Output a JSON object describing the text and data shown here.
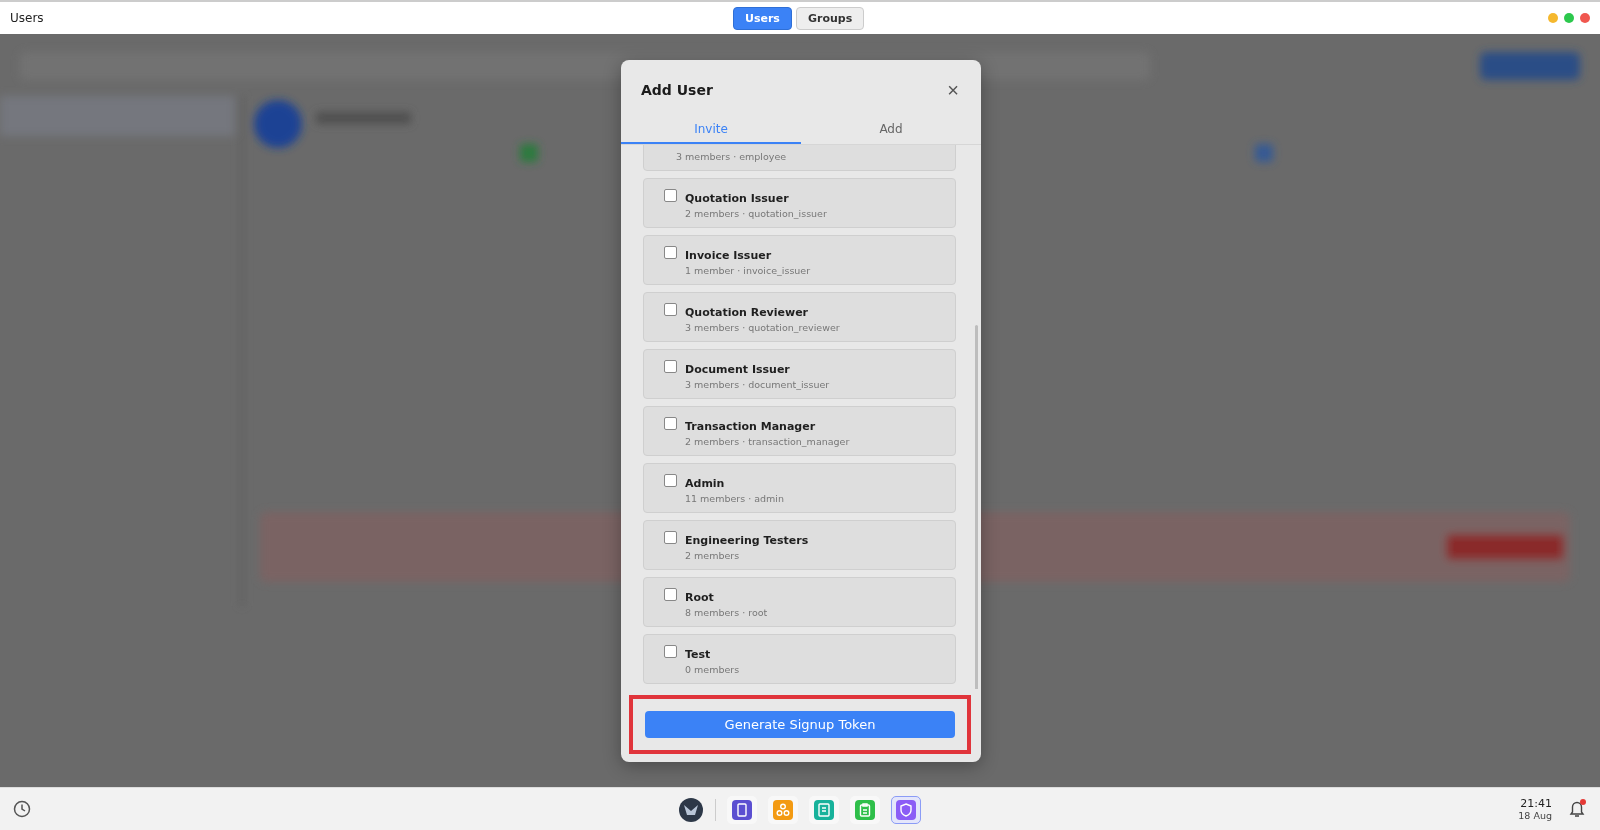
{
  "window": {
    "title": "Users"
  },
  "view_switch": [
    {
      "label": "Users",
      "selected": true
    },
    {
      "label": "Groups",
      "selected": false
    }
  ],
  "dialog": {
    "title": "Add User",
    "close": "×",
    "tabs": [
      {
        "label": "Invite",
        "selected": true
      },
      {
        "label": "Add",
        "selected": false
      }
    ],
    "groups": [
      {
        "meta": "3 members · employee"
      },
      {
        "name": "Quotation Issuer",
        "meta": "2 members · quotation_issuer",
        "checked": false
      },
      {
        "name": "Invoice Issuer",
        "meta": "1 member · invoice_issuer",
        "checked": false
      },
      {
        "name": "Quotation Reviewer",
        "meta": "3 members · quotation_reviewer",
        "checked": false
      },
      {
        "name": "Document Issuer",
        "meta": "3 members · document_issuer",
        "checked": false
      },
      {
        "name": "Transaction Manager",
        "meta": "2 members · transaction_manager",
        "checked": false
      },
      {
        "name": "Admin",
        "meta": "11 members · admin",
        "checked": false
      },
      {
        "name": "Engineering Testers",
        "meta": "2 members",
        "checked": false
      },
      {
        "name": "Root",
        "meta": "8 members · root",
        "checked": false
      },
      {
        "name": "Test",
        "meta": "0 members",
        "checked": false
      }
    ],
    "button": "Generate Signup Token",
    "highlighted": true
  },
  "taskbar": {
    "apps": [
      {
        "kind": "book",
        "color": "#5b4fd1",
        "selected": false
      },
      {
        "kind": "nodes",
        "color": "#f39a12",
        "selected": false
      },
      {
        "kind": "doc",
        "color": "#17b29b",
        "selected": false
      },
      {
        "kind": "clipboard",
        "color": "#2fbf4a",
        "selected": false
      },
      {
        "kind": "shield",
        "color": "#8b5cf6",
        "selected": true
      }
    ],
    "time": "21:41",
    "date": "18 Aug",
    "notification": true
  }
}
